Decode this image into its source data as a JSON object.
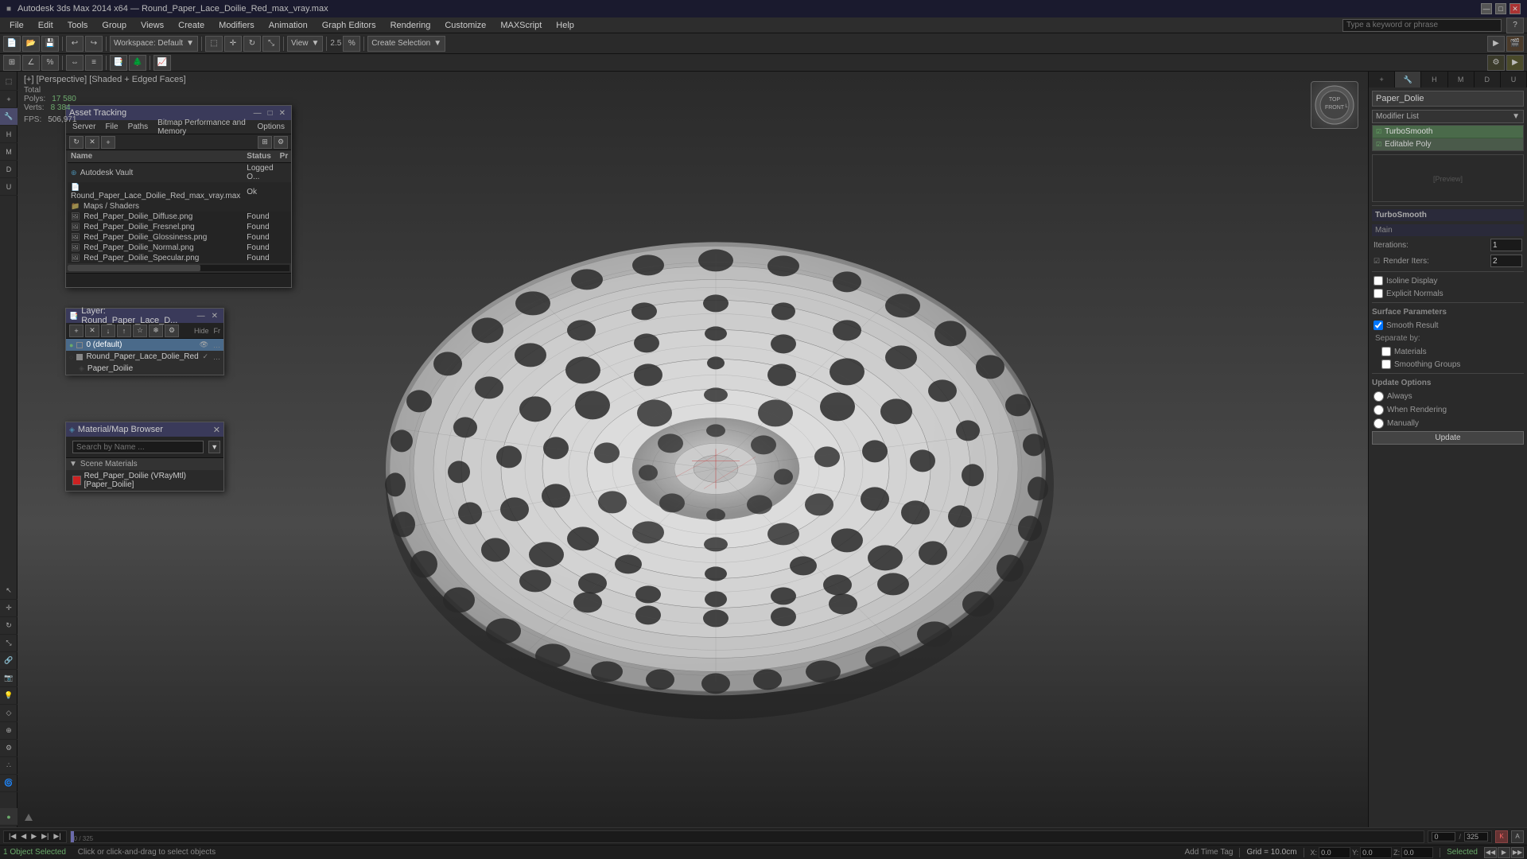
{
  "titlebar": {
    "title": "Autodesk 3ds Max 2014 x64 — Round_Paper_Lace_Doilie_Red_max_vray.max",
    "minimize": "—",
    "maximize": "□",
    "close": "✕"
  },
  "menubar": {
    "items": [
      "File",
      "Edit",
      "Tools",
      "Group",
      "Views",
      "Create",
      "Modifiers",
      "Animation",
      "Graph Editors",
      "Rendering",
      "Customize",
      "MAXScript",
      "Help"
    ]
  },
  "toolbar1": {
    "workspace_label": "Workspace: Default"
  },
  "viewport": {
    "label": "[+] [Perspective] [Shaded + Edged Faces]",
    "stats": {
      "polys_label": "Polys:",
      "polys_value": "17 580",
      "verts_label": "Verts:",
      "verts_value": "8 384",
      "fps_label": "FPS:",
      "fps_value": "506,971"
    }
  },
  "asset_tracking": {
    "title": "Asset Tracking",
    "menus": [
      "Server",
      "File",
      "Paths",
      "Bitmap Performance and Memory",
      "Options"
    ],
    "columns": [
      "Name",
      "Status",
      "Pr"
    ],
    "items": [
      {
        "indent": 0,
        "icon": "vault",
        "name": "Autodesk Vault",
        "status": "Logged O...",
        "pr": ""
      },
      {
        "indent": 1,
        "icon": "file",
        "name": "Round_Paper_Lace_Doilie_Red_max_vray.max",
        "status": "Ok",
        "pr": ""
      },
      {
        "indent": 2,
        "icon": "folder",
        "name": "Maps / Shaders",
        "status": "",
        "pr": ""
      },
      {
        "indent": 3,
        "icon": "img",
        "name": "Red_Paper_Doilie_Diffuse.png",
        "status": "Found",
        "pr": ""
      },
      {
        "indent": 3,
        "icon": "img",
        "name": "Red_Paper_Doilie_Fresnel.png",
        "status": "Found",
        "pr": ""
      },
      {
        "indent": 3,
        "icon": "img",
        "name": "Red_Paper_Doilie_Glossiness.png",
        "status": "Found",
        "pr": ""
      },
      {
        "indent": 3,
        "icon": "img",
        "name": "Red_Paper_Doilie_Normal.png",
        "status": "Found",
        "pr": ""
      },
      {
        "indent": 3,
        "icon": "img",
        "name": "Red_Paper_Doilie_Specular.png",
        "status": "Found",
        "pr": ""
      }
    ]
  },
  "layer_panel": {
    "title": "Layer: Round_Paper_Lace_D...",
    "layers": [
      {
        "name": "0 (default)",
        "active": true,
        "visible": true
      },
      {
        "name": "Round_Paper_Lace_Dolie_Red",
        "active": false,
        "visible": true
      },
      {
        "name": "Paper_Doilie",
        "active": false,
        "visible": true,
        "indent": true
      }
    ]
  },
  "material_panel": {
    "title": "Material/Map Browser",
    "search_placeholder": "Search by Name ...",
    "section": "Scene Materials",
    "materials": [
      {
        "name": "Red_Paper_Doilie (VRayMtl) [Paper_Doilie]",
        "color": "#cc2222"
      }
    ]
  },
  "right_panel": {
    "object_name": "Paper_Dolie",
    "modifier_list_label": "Modifier List",
    "modifiers": [
      {
        "name": "TurboSmooth",
        "active": true
      },
      {
        "name": "Editable Poly",
        "active": true
      }
    ],
    "turbos mooth": {
      "section": "TurboSmooth",
      "main_label": "Main",
      "iterations_label": "Iterations:",
      "iterations_value": "1",
      "render_iters_label": "Render Iters:",
      "render_iters_value": "2",
      "isoline_display": "Isoline Display",
      "explicit_normals": "Explicit Normals",
      "surface_params": "Surface Parameters",
      "smooth_result": "Smooth Result",
      "separate_by_label": "Separate by:",
      "materials_label": "Materials",
      "smoothing_groups": "Smoothing Groups",
      "update_options": "Update Options",
      "always": "Always",
      "when_rendering": "When Rendering",
      "manually": "Manually",
      "update_btn": "Update"
    }
  },
  "status_bar": {
    "message": "1 Object Selected",
    "hint": "Click or click-and-drag to select objects",
    "grid": "Grid = 10.0cm",
    "time": "Add Time Tag",
    "selected": "Selected"
  },
  "timeline": {
    "position": "0 / 325"
  },
  "colors": {
    "accent_blue": "#4a6a8a",
    "active_green": "#6aaa6a",
    "panel_bg": "#2e2e2e",
    "toolbar_bg": "#2a2a2a"
  }
}
